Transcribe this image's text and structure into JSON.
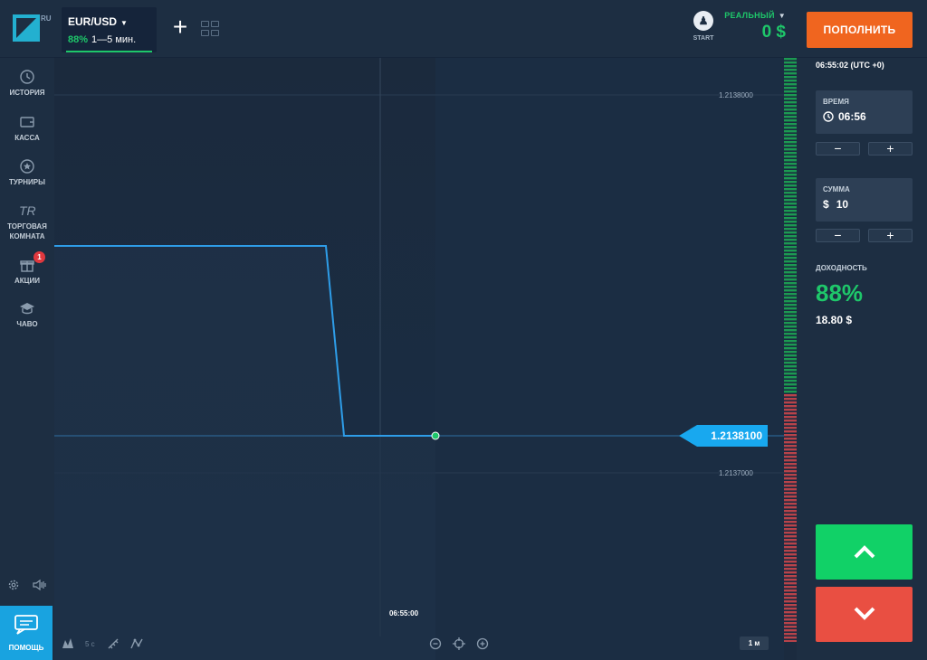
{
  "topbar": {
    "logo_ru": "RU",
    "asset": {
      "name": "EUR/USD",
      "pct": "88%",
      "expiry": "1—5 мин."
    },
    "start_label": "START",
    "start_icon": "pawn-icon",
    "account_type": "РЕАЛЬНЫЙ",
    "balance": "0 $",
    "deposit_label": "ПОПОЛНИТЬ"
  },
  "nav": {
    "items": [
      {
        "label": "ИСТОРИЯ",
        "icon": "history-icon"
      },
      {
        "label": "КАССА",
        "icon": "wallet-icon"
      },
      {
        "label": "ТУРНИРЫ",
        "icon": "star-icon"
      },
      {
        "label": "ТОРГОВАЯ\nКОМНАТА",
        "icon": "tr-icon",
        "glyph": "TR"
      },
      {
        "label": "АКЦИИ",
        "icon": "gift-icon",
        "badge": "1"
      },
      {
        "label": "ЧАВО",
        "icon": "graduation-cap-icon"
      }
    ],
    "help_label": "ПОМОЩЬ"
  },
  "chart": {
    "price_tag": "1.2138100",
    "level_high": "1.2138000",
    "level_low": "1.2137000",
    "time_label": "06:55:00",
    "interval": "5 с",
    "timeframe": "1 м",
    "colors": {
      "line": "#2e9de8",
      "marker": "#1ec76a",
      "tag": "#18a8ef"
    }
  },
  "panel": {
    "clock": "06:55:02 (UTC +0)",
    "time": {
      "label": "ВРЕМЯ",
      "value": "06:56"
    },
    "amount": {
      "label": "СУММА",
      "currency": "$",
      "value": "10"
    },
    "minus": "−",
    "plus": "+",
    "yield_label": "ДОХОДНОСТЬ",
    "yield_pct": "88%",
    "yield_amount": "18.80 $",
    "up_color": "#11d167",
    "down_color": "#e94f42"
  }
}
